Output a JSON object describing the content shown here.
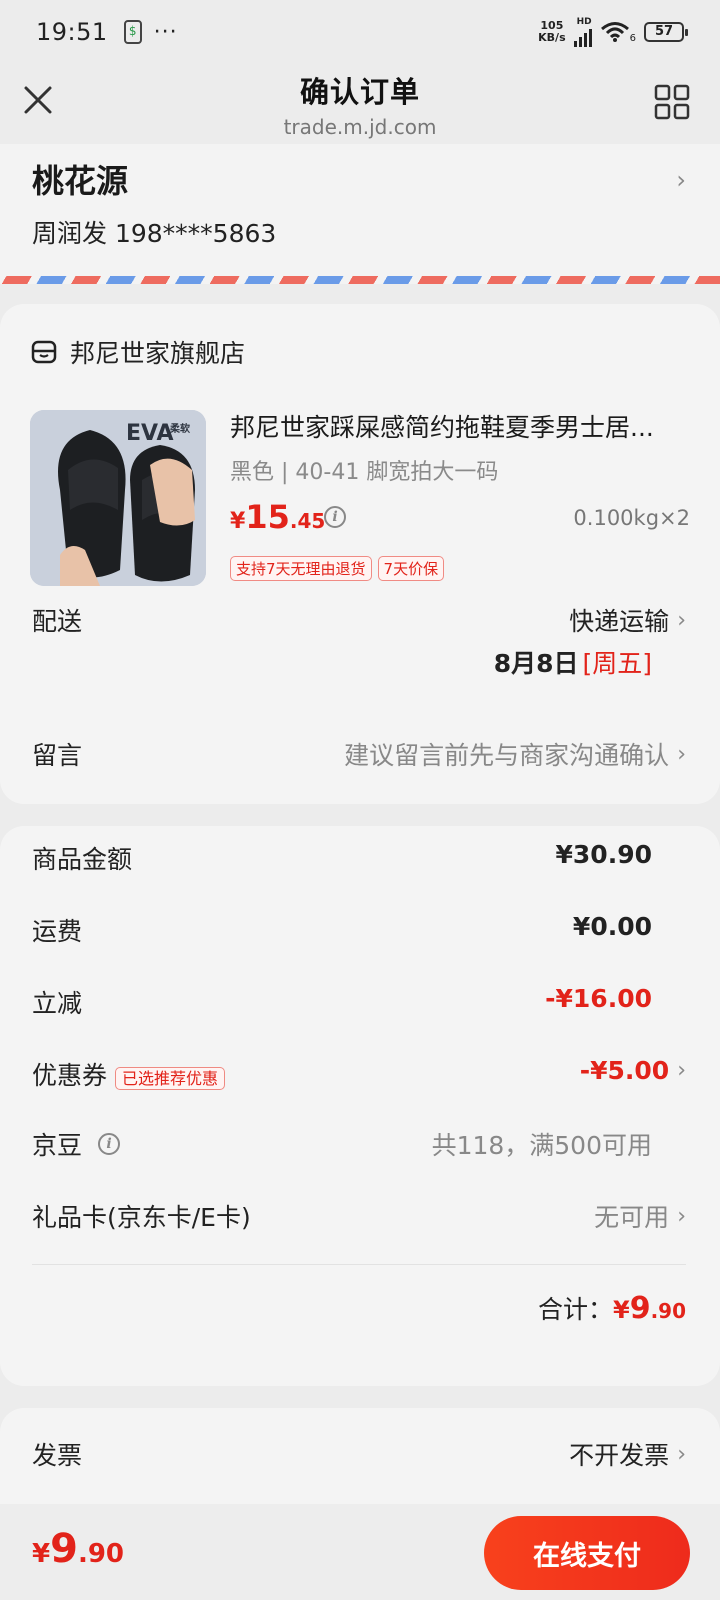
{
  "status_bar": {
    "time": "19:51",
    "dots": "···",
    "net_speed_top": "105",
    "net_speed_bottom": "KB/s",
    "hd": "HD",
    "wifi_sub": "6",
    "battery": "57"
  },
  "nav": {
    "title": "确认订单",
    "url": "trade.m.jd.com"
  },
  "address": {
    "name": "桃花源",
    "contact": "周润发 198****5863"
  },
  "shop": {
    "name": "邦尼世家旗舰店"
  },
  "product": {
    "title": "邦尼世家踩屎感简约拖鞋夏季男士居...",
    "spec": "黑色 | 40-41 脚宽拍大一码",
    "price_currency": "¥",
    "price_int": "15",
    "price_dec": ".45",
    "weight": "0.100kg×2",
    "tags": [
      "支持7天无理由退货",
      "7天价保"
    ],
    "image_text": "EVA",
    "image_subtext": "柔软"
  },
  "delivery": {
    "label": "配送",
    "method": "快递运输",
    "date": "8月8日",
    "weekday": "[周五]"
  },
  "message": {
    "label": "留言",
    "placeholder": "建议留言前先与商家沟通确认"
  },
  "summary": {
    "goods_label": "商品金额",
    "goods_value": "¥30.90",
    "shipping_label": "运费",
    "shipping_value": "¥0.00",
    "discount_label": "立减",
    "discount_value": "-¥16.00",
    "coupon_label": "优惠券",
    "coupon_tag": "已选推荐优惠",
    "coupon_value": "-¥5.00",
    "jingdou_label": "京豆",
    "jingdou_value": "共118，满500可用",
    "giftcard_label": "礼品卡(京东卡/E卡)",
    "giftcard_value": "无可用",
    "total_label": "合计：",
    "total_currency": "¥",
    "total_int": "9",
    "total_dec": ".90"
  },
  "invoice": {
    "label": "发票",
    "value": "不开发票"
  },
  "bottom": {
    "currency": "¥",
    "price_int": "9",
    "price_dec": ".90",
    "pay_label": "在线支付"
  },
  "colors": {
    "accent_red": "#e2231a",
    "airmail_red": "#ee6b5f",
    "airmail_blue": "#6a9be8"
  }
}
